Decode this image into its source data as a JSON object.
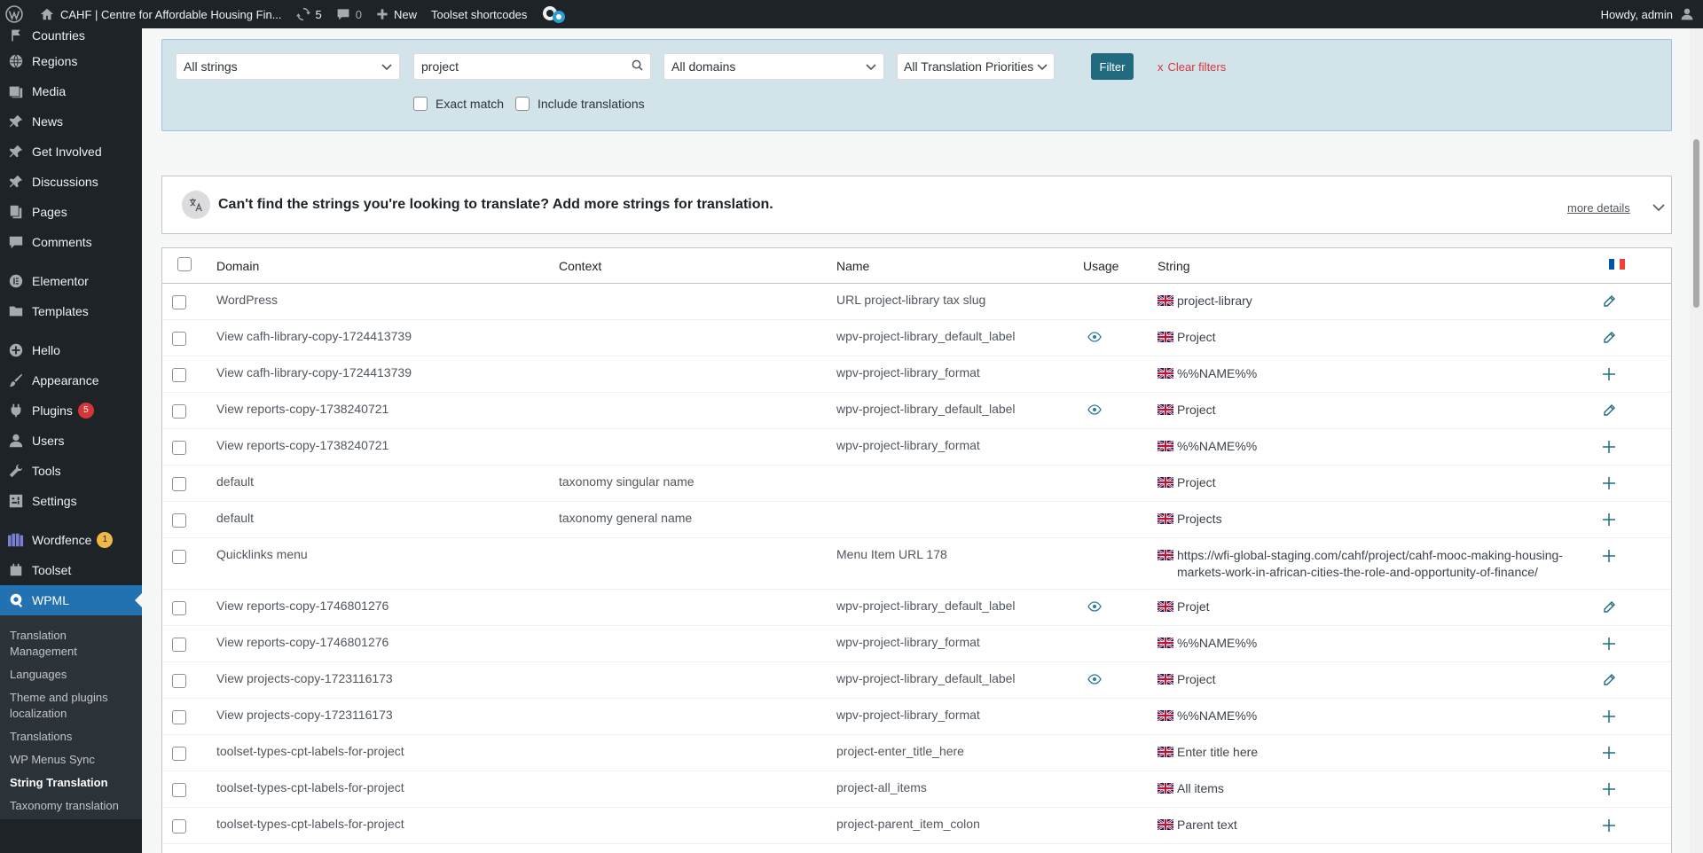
{
  "admin_bar": {
    "site_name": "CAHF | Centre for Affordable Housing Fin...",
    "updates_count": "5",
    "comments_count": "0",
    "new_label": "New",
    "toolset_label": "Toolset shortcodes",
    "howdy": "Howdy, admin"
  },
  "sidebar": {
    "items": [
      {
        "label": "Countries",
        "icon": "pin-icon"
      },
      {
        "label": "Regions",
        "icon": "globe-icon"
      },
      {
        "label": "Media",
        "icon": "media-icon"
      },
      {
        "label": "News",
        "icon": "pin-icon"
      },
      {
        "label": "Get Involved",
        "icon": "pin-icon"
      },
      {
        "label": "Discussions",
        "icon": "pin-icon"
      },
      {
        "label": "Pages",
        "icon": "pages-icon"
      },
      {
        "label": "Comments",
        "icon": "comment-icon"
      },
      {
        "label": "Elementor",
        "icon": "elementor-icon"
      },
      {
        "label": "Templates",
        "icon": "folder-icon"
      },
      {
        "label": "Hello",
        "icon": "plus-circle-icon"
      },
      {
        "label": "Appearance",
        "icon": "brush-icon"
      },
      {
        "label": "Plugins",
        "icon": "plugin-icon",
        "badge": "5"
      },
      {
        "label": "Users",
        "icon": "user-icon"
      },
      {
        "label": "Tools",
        "icon": "wrench-icon"
      },
      {
        "label": "Settings",
        "icon": "settings-icon"
      },
      {
        "label": "Wordfence",
        "icon": "wordfence-icon",
        "badge": "1"
      },
      {
        "label": "Toolset",
        "icon": "toolset-icon"
      },
      {
        "label": "WPML",
        "icon": "wpml-icon"
      }
    ],
    "submenu": [
      "Translation Management",
      "Languages",
      "Theme and plugins localization",
      "Translations",
      "WP Menus Sync",
      "String Translation",
      "Taxonomy translation"
    ]
  },
  "filters": {
    "strings_select": "All strings",
    "search_value": "project",
    "domains_select": "All domains",
    "priorities_select": "All Translation Priorities",
    "filter_button": "Filter",
    "clear_filters": "Clear filters",
    "clear_x": "x",
    "exact_match": "Exact match",
    "include_translations": "Include translations"
  },
  "notice": {
    "text": "Can't find the strings you're looking to translate? Add more strings for translation.",
    "more_details": "more details"
  },
  "table": {
    "headers": {
      "domain": "Domain",
      "context": "Context",
      "name": "Name",
      "usage": "Usage",
      "string": "String"
    },
    "rows": [
      {
        "domain": "WordPress",
        "context": "",
        "name": "URL project-library tax slug",
        "usage": false,
        "string": "project-library",
        "action": "edit"
      },
      {
        "domain": "View cafh-library-copy-1724413739",
        "context": "",
        "name": "wpv-project-library_default_label",
        "usage": true,
        "string": "Project",
        "action": "edit"
      },
      {
        "domain": "View cafh-library-copy-1724413739",
        "context": "",
        "name": "wpv-project-library_format",
        "usage": false,
        "string": "%%NAME%%",
        "action": "add"
      },
      {
        "domain": "View reports-copy-1738240721",
        "context": "",
        "name": "wpv-project-library_default_label",
        "usage": true,
        "string": "Project",
        "action": "edit"
      },
      {
        "domain": "View reports-copy-1738240721",
        "context": "",
        "name": "wpv-project-library_format",
        "usage": false,
        "string": "%%NAME%%",
        "action": "add"
      },
      {
        "domain": "default",
        "context": "taxonomy singular name",
        "name": "",
        "usage": false,
        "string": "Project",
        "action": "add"
      },
      {
        "domain": "default",
        "context": "taxonomy general name",
        "name": "",
        "usage": false,
        "string": "Projects",
        "action": "add"
      },
      {
        "domain": "Quicklinks menu",
        "context": "",
        "name": "Menu Item URL 178",
        "usage": false,
        "string": "https://wfi-global-staging.com/cahf/project/cahf-mooc-making-housing-markets-work-in-african-cities-the-role-and-opportunity-of-finance/",
        "action": "add"
      },
      {
        "domain": "View reports-copy-1746801276",
        "context": "",
        "name": "wpv-project-library_default_label",
        "usage": true,
        "string": "Projet",
        "action": "edit"
      },
      {
        "domain": "View reports-copy-1746801276",
        "context": "",
        "name": "wpv-project-library_format",
        "usage": false,
        "string": "%%NAME%%",
        "action": "add"
      },
      {
        "domain": "View projects-copy-1723116173",
        "context": "",
        "name": "wpv-project-library_default_label",
        "usage": true,
        "string": "Project",
        "action": "edit"
      },
      {
        "domain": "View projects-copy-1723116173",
        "context": "",
        "name": "wpv-project-library_format",
        "usage": false,
        "string": "%%NAME%%",
        "action": "add"
      },
      {
        "domain": "toolset-types-cpt-labels-for-project",
        "context": "",
        "name": "project-enter_title_here",
        "usage": false,
        "string": "Enter title here",
        "action": "add"
      },
      {
        "domain": "toolset-types-cpt-labels-for-project",
        "context": "",
        "name": "project-all_items",
        "usage": false,
        "string": "All items",
        "action": "add"
      },
      {
        "domain": "toolset-types-cpt-labels-for-project",
        "context": "",
        "name": "project-parent_item_colon",
        "usage": false,
        "string": "Parent text",
        "action": "add"
      }
    ]
  },
  "colors": {
    "admin_dark": "#1d2327",
    "accent_blue": "#2271b1",
    "filter_bg": "#d3e3ea",
    "filter_button": "#216b7e",
    "clear_red": "#d63638",
    "action_teal": "#216b7e"
  }
}
